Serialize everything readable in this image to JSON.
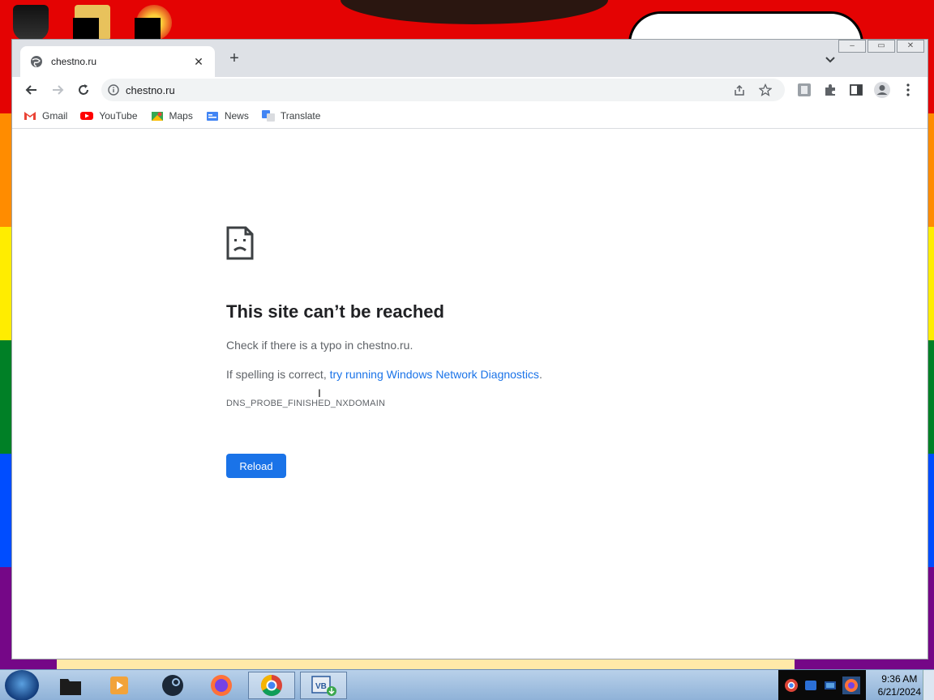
{
  "browser": {
    "tab": {
      "title": "chestno.ru",
      "close_label": "✕"
    },
    "new_tab_label": "+",
    "window_controls": [
      "–",
      "▭",
      "✕"
    ],
    "address": {
      "url": "chestno.ru"
    },
    "bookmarks": [
      {
        "label": "Gmail",
        "icon": "gmail-icon",
        "color": "#ea4335"
      },
      {
        "label": "YouTube",
        "icon": "youtube-icon",
        "color": "#ff0000"
      },
      {
        "label": "Maps",
        "icon": "maps-icon",
        "color": "#34a853"
      },
      {
        "label": "News",
        "icon": "news-icon",
        "color": "#4285f4"
      },
      {
        "label": "Translate",
        "icon": "translate-icon",
        "color": "#4285f4"
      }
    ]
  },
  "error": {
    "title": "This site can’t be reached",
    "line1": "Check if there is a typo in chestno.ru.",
    "line2_prefix": "If spelling is correct, ",
    "line2_link": "try running Windows Network Diagnostics",
    "line2_suffix": ".",
    "code": "DNS_PROBE_FINISHED_NXDOMAIN",
    "reload_label": "Reload"
  },
  "taskbar": {
    "items": [
      "explorer",
      "media-player",
      "steam",
      "firefox",
      "chrome",
      "virtualbox"
    ],
    "vb_label": "VB",
    "clock": {
      "time": "9:36 AM",
      "date": "6/21/2024"
    }
  },
  "colors": {
    "accent": "#1a73e8",
    "title_text": "#202124",
    "body_text": "#5f6368"
  }
}
